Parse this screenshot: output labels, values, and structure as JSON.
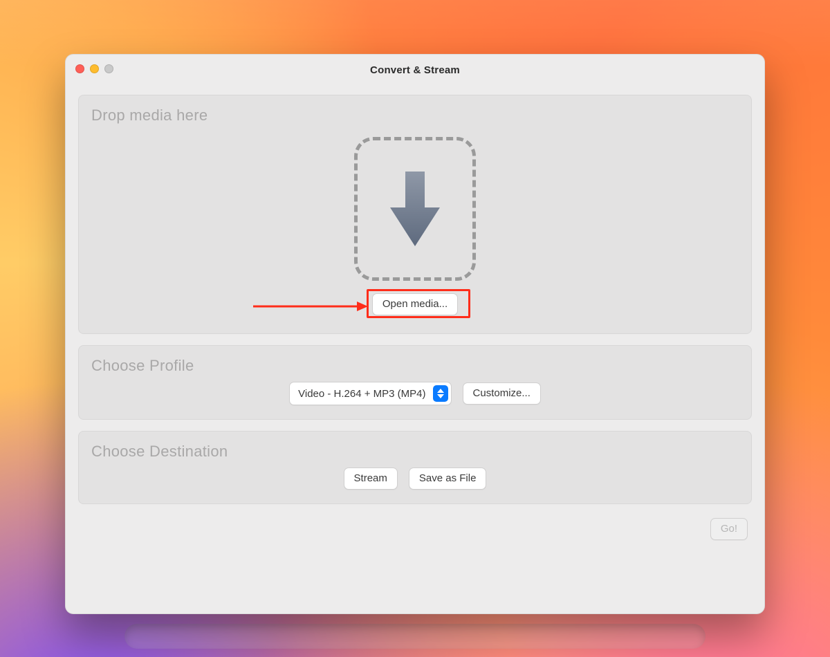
{
  "window": {
    "title": "Convert & Stream"
  },
  "dropzone": {
    "heading": "Drop media here",
    "open_button": "Open media..."
  },
  "profile": {
    "heading": "Choose Profile",
    "selected": "Video - H.264 + MP3 (MP4)",
    "customize": "Customize..."
  },
  "destination": {
    "heading": "Choose Destination",
    "stream": "Stream",
    "save": "Save as File"
  },
  "footer": {
    "go": "Go!"
  }
}
